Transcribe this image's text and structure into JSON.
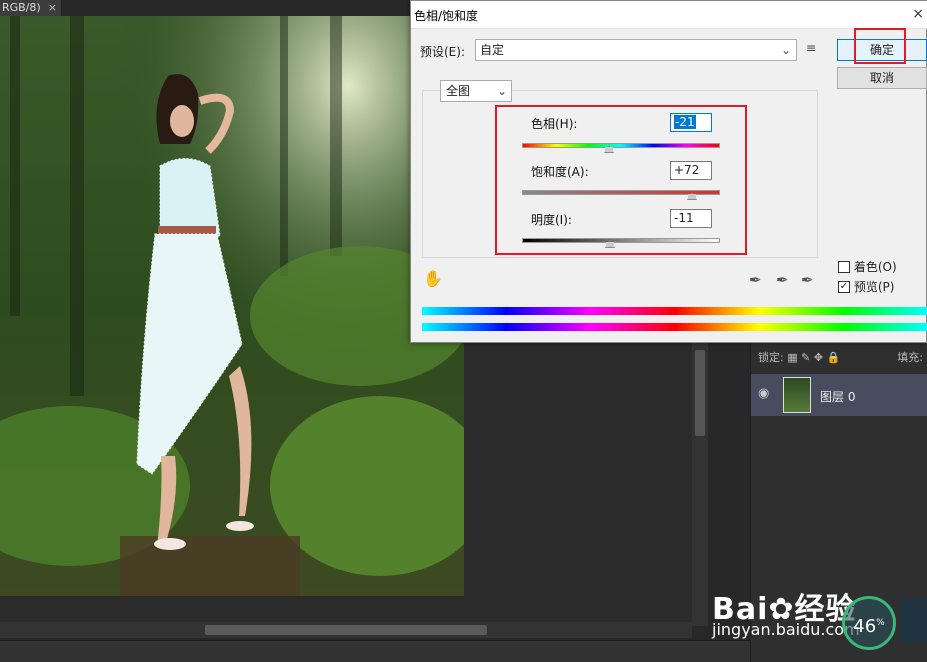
{
  "document": {
    "tab_label": "RGB/8)",
    "tab_close": "×"
  },
  "dialog": {
    "title": "色相/饱和度",
    "close": "×",
    "preset_label": "预设(E):",
    "preset_value": "自定",
    "ok_label": "确定",
    "cancel_label": "取消",
    "channel_value": "全图",
    "hue_label": "色相(H):",
    "hue_value": "-21",
    "hue_level": -21,
    "saturation_label": "饱和度(A):",
    "saturation_value": "+72",
    "saturation_level": 72,
    "lightness_label": "明度(I):",
    "lightness_value": "-11",
    "lightness_level": -11,
    "colorize_label": "着色(O)",
    "colorize_checked": false,
    "preview_label": "预览(P)",
    "preview_checked": true
  },
  "layers_panel": {
    "lock_label": "锁定:",
    "fill_label": "填充:",
    "layer_name": "图层 0"
  },
  "watermark": {
    "main": "Bai",
    "main_suffix": "经验",
    "sub": "jingyan.baidu.com"
  },
  "progress": {
    "value": "46",
    "unit": "%"
  },
  "colors": {
    "highlight_red": "#e21b2b",
    "focus_blue": "#0078d7"
  }
}
